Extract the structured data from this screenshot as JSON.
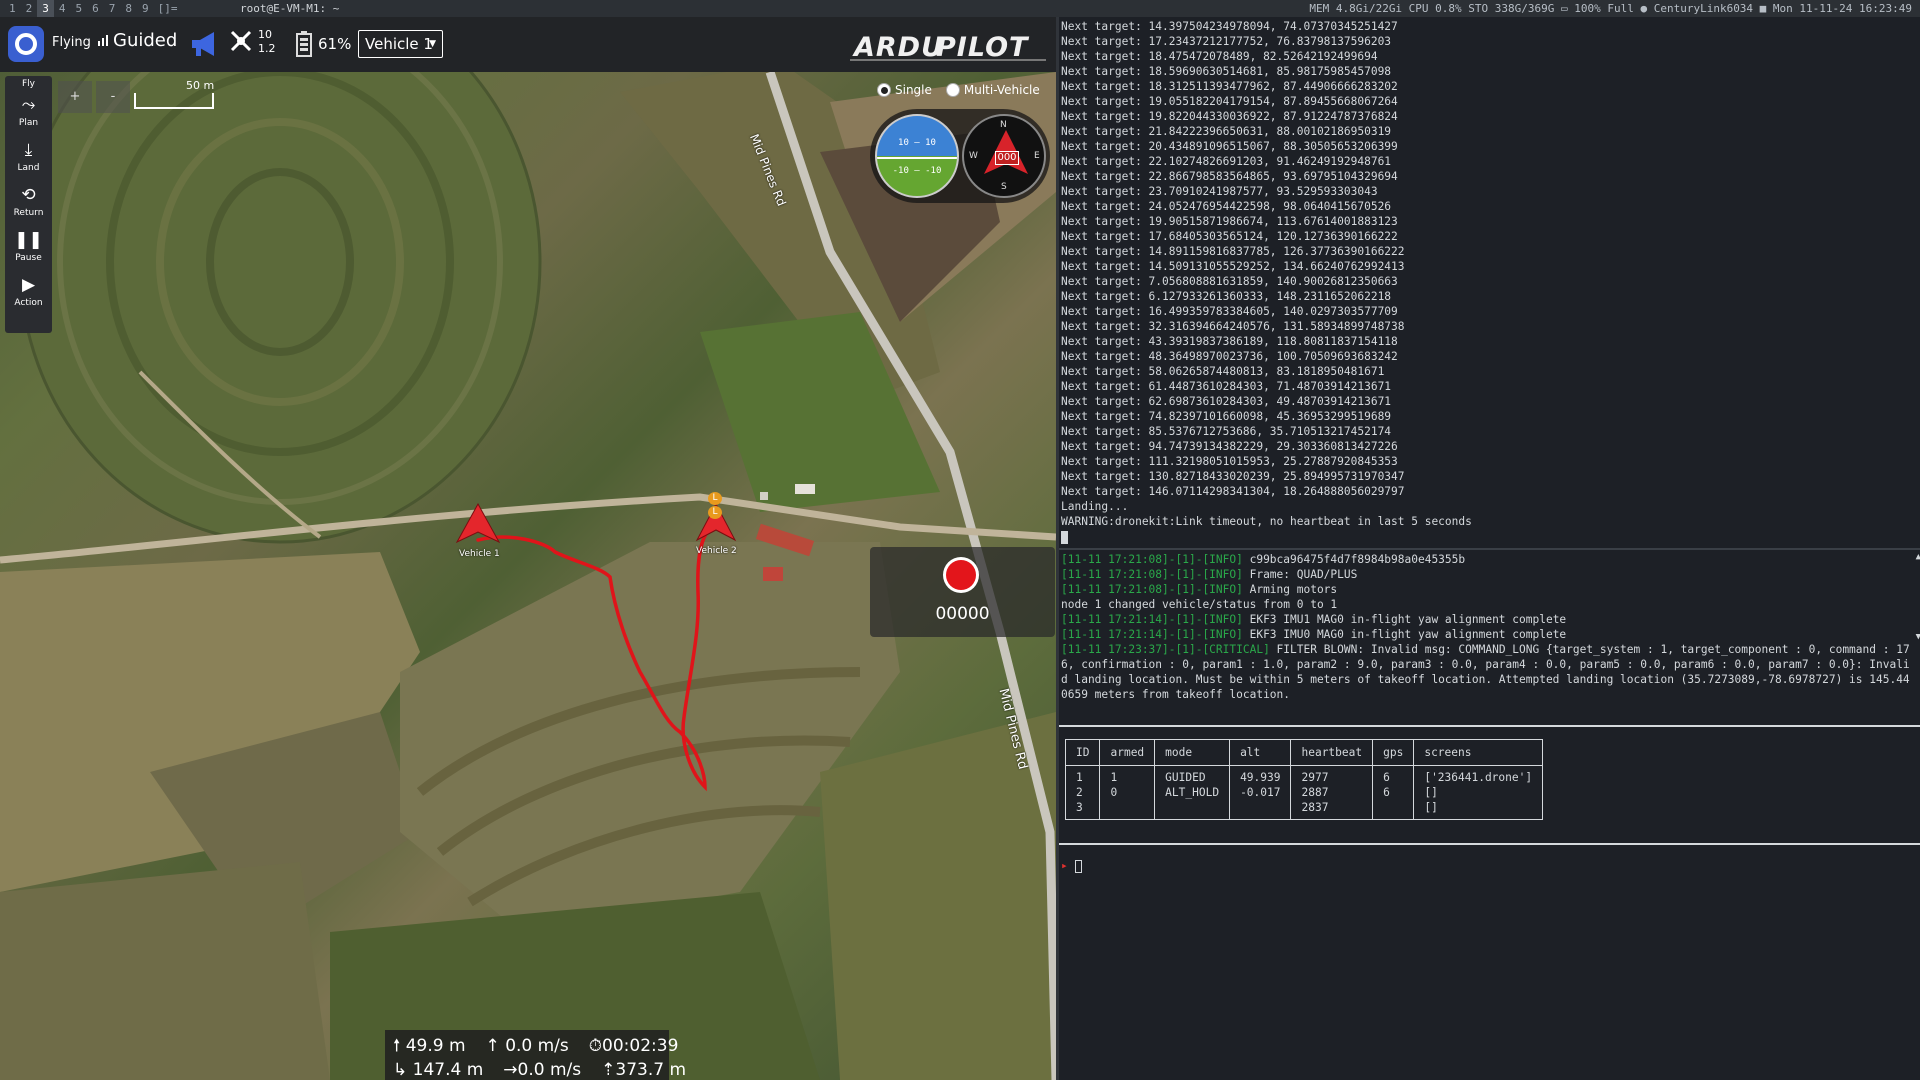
{
  "topbar": {
    "workspaces": [
      "1",
      "2",
      "3",
      "4",
      "5",
      "6",
      "7",
      "8",
      "9"
    ],
    "active_workspace": "3",
    "layout_indicator": "[]=",
    "window_title": "root@E-VM-M1: ~",
    "sysinfo": "MEM 4.8Gi/22Gi CPU 0.8% STO 338G/369G  ▭ 100% Full  ●  CenturyLink6034  ■ Mon 11-11-24 16:23:49"
  },
  "qgc": {
    "flight_status": "Flying",
    "flight_mode": "Guided",
    "gps_count": "10",
    "gps_hdop": "1.2",
    "battery_percent": "61%",
    "vehicle_selector": "Vehicle 1",
    "tools": [
      {
        "label": "Fly"
      },
      {
        "label": "Plan"
      },
      {
        "label": "Land"
      },
      {
        "label": "Return"
      },
      {
        "label": "Pause"
      },
      {
        "label": "Action"
      }
    ],
    "zoom_in": "+",
    "zoom_out": "-",
    "scale_label": "50 m",
    "view_single": "Single",
    "view_multi": "Multi-Vehicle",
    "attitude_top": "10 — 10",
    "attitude_bottom": "-10 — -10",
    "compass_n": "N",
    "compass_e": "E",
    "compass_s": "S",
    "compass_w": "W",
    "compass_heading": "000",
    "road_name_1": "Mid Pines Rd",
    "road_name_2": "Mid Pines Rd",
    "vehicle_1_label": "Vehicle 1",
    "vehicle_2_label": "Vehicle 2",
    "landing_marker": "L",
    "record_time": "00000",
    "telemetry": {
      "altitude": "49.9 m",
      "vertical_speed": "0.0 m/s",
      "flight_time": "00:02:39",
      "distance": "147.4 m",
      "ground_speed": "0.0 m/s",
      "distance_to_home": "373.7 m"
    },
    "colors": {
      "track": "#e0141a",
      "vehicle": "#e4262c",
      "landing_marker": "#e89a1e"
    }
  },
  "terminal": {
    "targets": [
      "Next target: 14.397504234978094, 74.07370345251427",
      "Next target: 17.23437212177752, 76.83798137596203",
      "Next target: 18.475472078489, 82.52642192499694",
      "Next target: 18.59690630514681, 85.98175985457098",
      "Next target: 18.312511393477962, 87.44906666283202",
      "Next target: 19.055182204179154, 87.89455668067264",
      "Next target: 19.822044330036922, 87.91224787376824",
      "Next target: 21.84222396650631, 88.00102186950319",
      "Next target: 20.434891096515067, 88.30505653206399",
      "Next target: 22.10274826691203, 91.46249192948761",
      "Next target: 22.866798583564865, 93.69795104329694",
      "Next target: 23.70910241987577, 93.529593303043",
      "Next target: 24.052476954422598, 98.0640415670526",
      "Next target: 19.90515871986674, 113.67614001883123",
      "Next target: 17.68405303565124, 120.12736390166222",
      "Next target: 14.891159816837785, 126.37736390166222",
      "Next target: 14.509131055529252, 134.66240762992413",
      "Next target: 7.056808881631859, 140.90026812350663",
      "Next target: 6.127933261360333, 148.2311652062218",
      "Next target: 16.499359783384605, 140.0297303577709",
      "Next target: 32.316394664240576, 131.58934899748738",
      "Next target: 43.39319837386189, 118.80811837154118",
      "Next target: 48.36498970023736, 100.70509693683242",
      "Next target: 58.06265874480813, 83.1818950481671",
      "Next target: 61.44873610284303, 71.48703914213671",
      "Next target: 62.69873610284303, 49.48703914213671",
      "Next target: 74.82397101660098, 45.36953299519689",
      "Next target: 85.5376712753686, 35.710513217452174",
      "Next target: 94.74739134382229, 29.303360813427226",
      "Next target: 111.32198051015953, 25.27887920845353",
      "Next target: 130.82718433020239, 25.894995731970347",
      "Next target: 146.07114298341304, 18.264888056029797",
      "Landing...",
      "WARNING:dronekit:Link timeout, no heartbeat in last 5 seconds"
    ],
    "log": [
      {
        "ts": "[11-11 17:21:08]-[1]-[INFO]",
        "msg": " c99bca96475f4d7f8984b98a0e45355b"
      },
      {
        "ts": "[11-11 17:21:08]-[1]-[INFO]",
        "msg": " Frame: QUAD/PLUS"
      },
      {
        "ts": "[11-11 17:21:08]-[1]-[INFO]",
        "msg": " Arming motors"
      },
      {
        "ts": "",
        "msg": "node 1 changed vehicle/status from 0 to 1"
      },
      {
        "ts": "[11-11 17:21:14]-[1]-[INFO]",
        "msg": " EKF3 IMU1 MAG0 in-flight yaw alignment complete"
      },
      {
        "ts": "[11-11 17:21:14]-[1]-[INFO]",
        "msg": " EKF3 IMU0 MAG0 in-flight yaw alignment complete"
      },
      {
        "ts": "[11-11 17:23:37]-[1]-[CRITICAL]",
        "msg": " FILTER BLOWN: Invalid msg: COMMAND_LONG {target_system : 1, target_component : 0, command : 176, confirmation : 0, param1 : 1.0, param2 : 9.0, param3 : 0.0, param4 : 0.0, param5 : 0.0, param6 : 0.0, param7 : 0.0}: Invalid landing location. Must be within 5 meters of takeoff location. Attempted landing location (35.7273089,-78.6978727) is 145.440659 meters from takeoff location."
      }
    ],
    "table": {
      "headers": [
        "ID",
        "armed",
        "mode",
        "alt",
        "heartbeat",
        "gps",
        "screens"
      ],
      "rows": [
        [
          "1",
          "1",
          "GUIDED",
          "49.939",
          "2977",
          "6",
          "['236441.drone']"
        ],
        [
          "2",
          "0",
          "ALT_HOLD",
          "-0.017",
          "2887",
          "6",
          "[]"
        ],
        [
          "3",
          "",
          "",
          "",
          "2837",
          "",
          "[]"
        ]
      ]
    },
    "prompt_symbol": "▸"
  }
}
